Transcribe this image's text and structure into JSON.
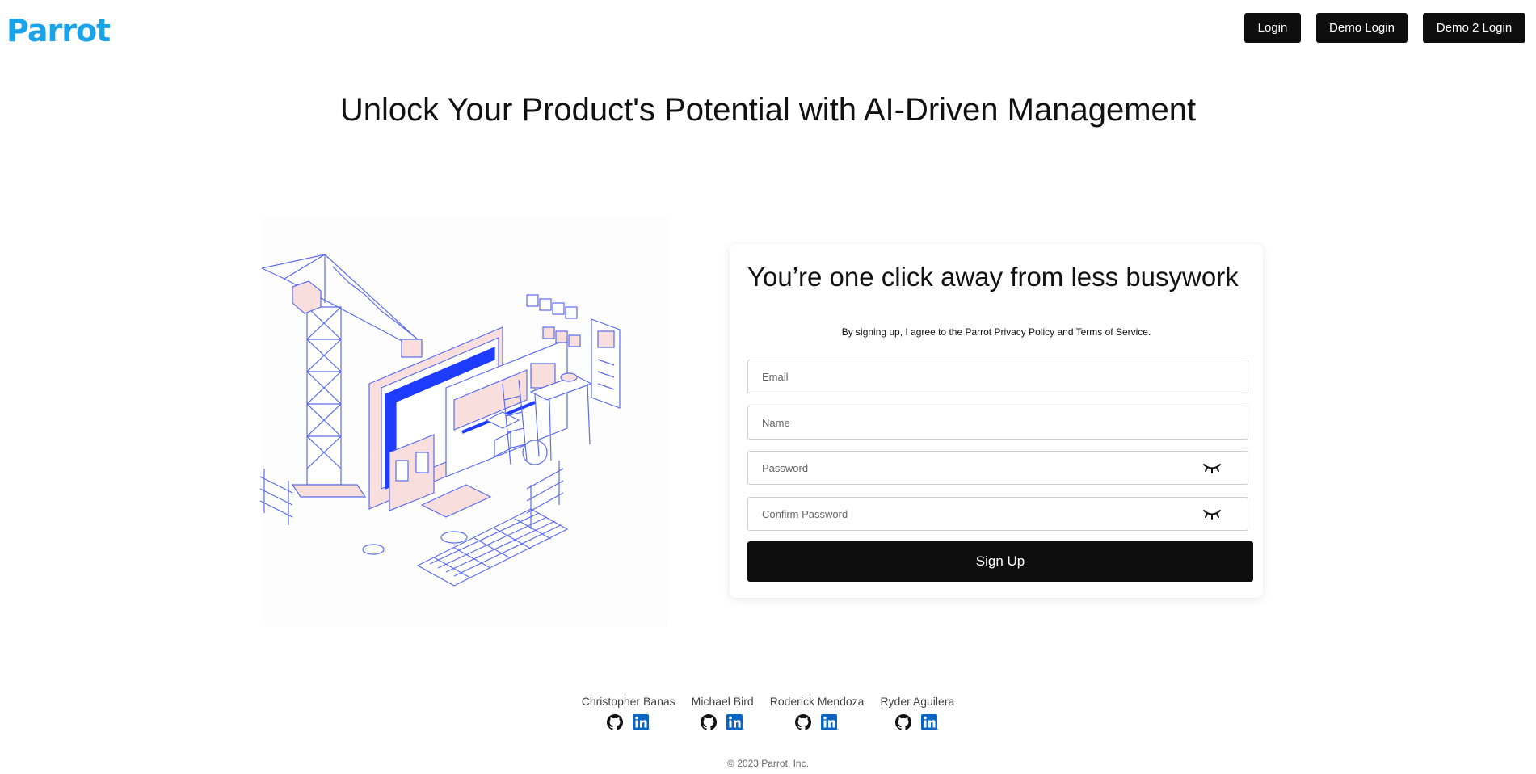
{
  "header": {
    "logo_text": "Parrot",
    "nav": {
      "login": "Login",
      "demo_login": "Demo Login",
      "demo2_login": "Demo 2 Login"
    }
  },
  "hero": {
    "title": "Unlock Your Product's Potential with AI-Driven Management"
  },
  "signup": {
    "title": "You’re one click away from less busywork",
    "terms": "By signing up, I agree to the Parrot Privacy Policy and Terms of Service.",
    "email_placeholder": "Email",
    "name_placeholder": "Name",
    "password_placeholder": "Password",
    "confirm_placeholder": "Confirm Password",
    "submit": "Sign Up"
  },
  "team": [
    {
      "name": "Christopher Banas"
    },
    {
      "name": "Michael Bird"
    },
    {
      "name": "Roderick Mendoza"
    },
    {
      "name": "Ryder Aguilera"
    }
  ],
  "footer": {
    "copyright": "© 2023 Parrot, Inc."
  },
  "colors": {
    "brand": "#1aa3e8",
    "button": "#0e0e0e",
    "linkedin": "#0a66c2",
    "illustration_line": "#5b6cf0",
    "illustration_fill": "#f9dede"
  },
  "icons": [
    "eye-closed-icon",
    "github-icon",
    "linkedin-icon"
  ]
}
